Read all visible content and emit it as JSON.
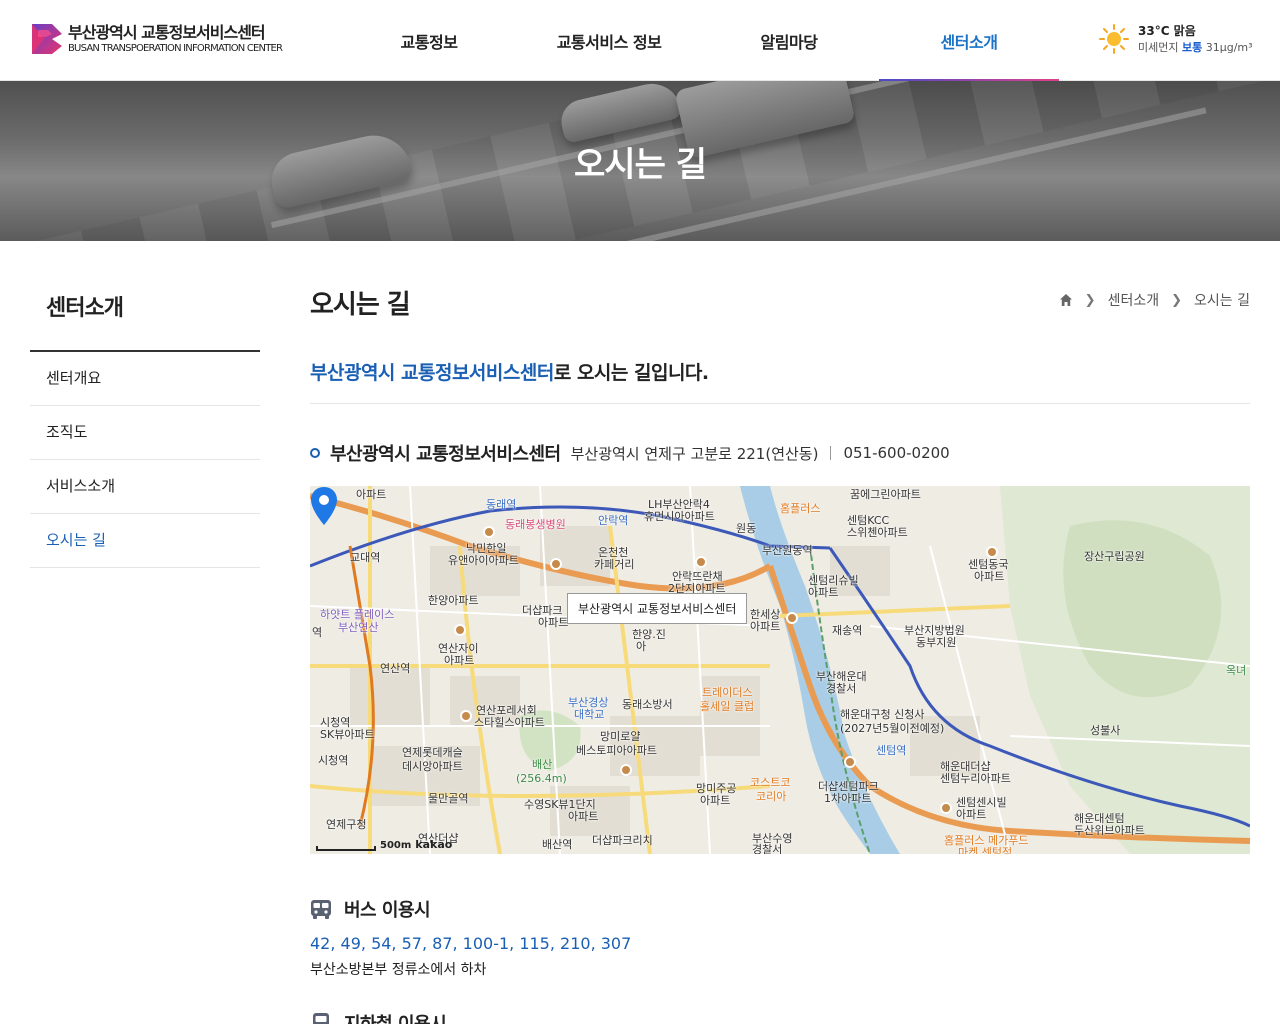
{
  "header": {
    "logo_ko": "부산광역시 교통정보서비스센터",
    "logo_en": "BUSAN TRANSPOERATION INFORMATION CENTER",
    "nav": [
      {
        "label": "교통정보"
      },
      {
        "label": "교통서비스 정보"
      },
      {
        "label": "알림마당"
      },
      {
        "label": "센터소개",
        "active": true
      }
    ],
    "weather": {
      "icon": "sun-icon",
      "temp_condition": "33°C 맑음",
      "dust_label": "미세먼지",
      "dust_status": "보통",
      "dust_value": "31µg/m³"
    }
  },
  "hero": {
    "title": "오시는 길"
  },
  "sidebar": {
    "title": "센터소개",
    "items": [
      {
        "label": "센터개요"
      },
      {
        "label": "조직도"
      },
      {
        "label": "서비스소개"
      },
      {
        "label": "오시는 길",
        "active": true
      }
    ]
  },
  "content": {
    "title": "오시는 길",
    "breadcrumb": [
      "센터소개",
      "오시는 길"
    ],
    "intro_highlight": "부산광역시 교통정보서비스센터",
    "intro_rest": "로 오시는 길입니다.",
    "place_name": "부산광역시 교통정보서비스센터",
    "address": "부산광역시 연제구 고분로 221(연산동)",
    "phone": "051-600-0200"
  },
  "map": {
    "tooltip": "부산광역시 교통정보서비스센터",
    "scale": "500m",
    "provider": "kakao",
    "labels": {
      "l01": "아파트",
      "l02": "동래역",
      "l03": "LH부산안락4",
      "l04": "휴먼시아아파트",
      "l05": "홈플러스",
      "l06": "꿈에그린아파트",
      "l07": "동래봉생병원",
      "l08": "안락역",
      "l09": "원동",
      "l10": "센텀KCC",
      "l11": "스위첸아파트",
      "l12": "교대역",
      "l13": "낙민한일",
      "l14": "유앤아이아파트",
      "l15": "온천천",
      "l16": "카페거리",
      "l17": "부산원동역",
      "l18": "안락뜨란채",
      "l19": "2단지아파트",
      "l20": "센텀동국",
      "l21": "아파트",
      "l22": "장산구립공원",
      "l23": "센텀리슈빌",
      "l24": "아파트",
      "l25": "하얏트 플레이스",
      "l26": "부산연산",
      "l27": "한양아파트",
      "l28": "더샵파크",
      "l29": "아파트",
      "l30": "한세상",
      "l31": "아파트",
      "l32": "재송역",
      "l33": "부산지방법원",
      "l34": "동부지원",
      "l35": "역",
      "l36": "연산자이",
      "l37": "아파트",
      "l38": "한양.진",
      "l39": "아",
      "l40": "연산역",
      "l41": "부산해운대",
      "l42": "경찰서",
      "l43": "옥녀",
      "l44": "트레이더스",
      "l45": "홀세일 클럽",
      "l46": "부산경상",
      "l47": "대학교",
      "l48": "동래소방서",
      "l49": "연산포레서회",
      "l50": "스타힐스아파트",
      "l51": "해운대구청 신청사",
      "l52": "(2027년5월이전예정)",
      "l53": "성불사",
      "l54": "시청역",
      "l55": "SK뷰아파트",
      "l56": "연제롯데캐슬",
      "l57": "데시앙아파트",
      "l58": "배산",
      "l59": "(256.4m)",
      "l60": "망미로얄",
      "l61": "베스토피아아파트",
      "l62": "센텀역",
      "l63": "해운대더샵",
      "l64": "센텀누리아파트",
      "l65": "시청역",
      "l66": "물만골역",
      "l67": "코스트코",
      "l68": "코리아",
      "l69": "망미주공",
      "l70": "아파트",
      "l71": "더샵센텀파크",
      "l72": "1차아파트",
      "l73": "센텀센시빌",
      "l74": "아파트",
      "l75": "수영SK뷰1단지",
      "l76": "아파트",
      "l77": "연제구청",
      "l78": "해운대센텀",
      "l79": "두산위브아파트",
      "l80": "연산더샵",
      "l81": "배산역",
      "l82": "더샵파크리치",
      "l83": "부산수영",
      "l84": "경찰서",
      "l85": "홈플러스 메가푸드",
      "l86": "마켓 센텀점"
    }
  },
  "transit": {
    "bus_title": "버스 이용시",
    "bus_routes": "42, 49, 54, 57, 87, 100-1, 115, 210, 307",
    "bus_desc": "부산소방본부 정류소에서 하차",
    "subway_title": "지하철 이용시"
  },
  "colors": {
    "accent": "#1a5fb4",
    "nav_active": "#1a73c8",
    "logo_pink": "#e8336f",
    "logo_purple": "#6a3fc4"
  }
}
